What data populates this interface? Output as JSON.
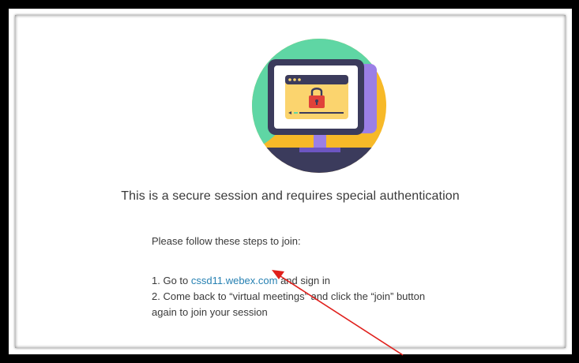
{
  "page": {
    "headline": "This is a secure session and requires special authentication",
    "instructions_intro": "Please follow these steps to join:",
    "step1_prefix": "1. Go to ",
    "step1_link": "cssd11.webex.com",
    "step1_suffix": " and sign in",
    "step2_line1": "2. Come back to “virtual meetings” and click the “join” button",
    "step2_line2": "again to join your session"
  },
  "illustration": {
    "icon": "secure-session-monitor-lock-icon",
    "colors": {
      "circle_teal": "#5fd6a4",
      "circle_yellow": "#f7b928",
      "base_navy": "#3b3b5c",
      "monitor_purple": "#9b7fe6",
      "screen_yellow": "#fbd46e",
      "lock_red": "#e0423a"
    }
  },
  "annotation": {
    "arrow_color": "#e0201c"
  }
}
